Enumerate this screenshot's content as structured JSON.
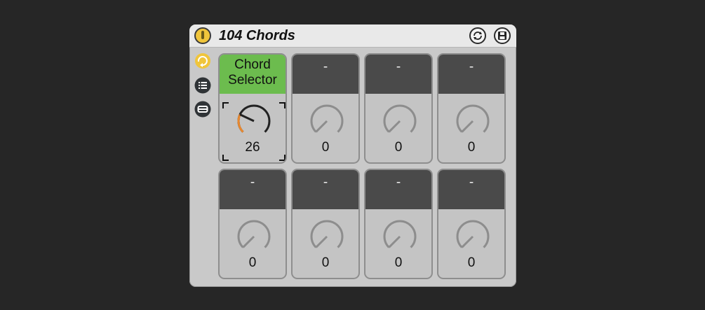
{
  "device": {
    "title": "104 Chords"
  },
  "icons": {
    "power": "power-icon",
    "hot_swap": "hot-swap-icon",
    "save_preset": "save-icon",
    "randomize": "randomize-icon",
    "variations": "variations-list-icon",
    "map": "map-icon"
  },
  "colors": {
    "active_macro_label": "#6cbc4e",
    "knob_arc": "#e8882f",
    "power_on": "#f0c53b"
  },
  "macros": [
    {
      "label": "Chord Selector",
      "label_lines": [
        "Chord",
        "Selector"
      ],
      "value": "26",
      "active": true,
      "level": 0.26
    },
    {
      "label": "-",
      "label_lines": [
        "-"
      ],
      "value": "0",
      "active": false,
      "level": 0
    },
    {
      "label": "-",
      "label_lines": [
        "-"
      ],
      "value": "0",
      "active": false,
      "level": 0
    },
    {
      "label": "-",
      "label_lines": [
        "-"
      ],
      "value": "0",
      "active": false,
      "level": 0
    },
    {
      "label": "-",
      "label_lines": [
        "-"
      ],
      "value": "0",
      "active": false,
      "level": 0
    },
    {
      "label": "-",
      "label_lines": [
        "-"
      ],
      "value": "0",
      "active": false,
      "level": 0
    },
    {
      "label": "-",
      "label_lines": [
        "-"
      ],
      "value": "0",
      "active": false,
      "level": 0
    },
    {
      "label": "-",
      "label_lines": [
        "-"
      ],
      "value": "0",
      "active": false,
      "level": 0
    }
  ]
}
